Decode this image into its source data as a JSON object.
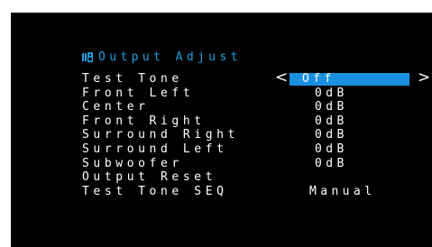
{
  "menu": {
    "title": "Output Adjust",
    "title_icon": "speaker-icon",
    "accent_color": "#1ea0e6",
    "highlight_color": "#1a8fe0",
    "background_color": "#000000"
  },
  "rows": [
    {
      "label": "Test Tone",
      "value": "Off",
      "selected": true
    },
    {
      "label": "Front Left",
      "value": "0dB"
    },
    {
      "label": "Center",
      "value": "0dB"
    },
    {
      "label": "Front Right",
      "value": "0dB"
    },
    {
      "label": "Surround Right",
      "value": "0dB"
    },
    {
      "label": "Surround Left",
      "value": "0dB"
    },
    {
      "label": "Subwoofer",
      "value": "0dB"
    },
    {
      "label": "Output Reset",
      "value": ""
    },
    {
      "label": "Test Tone SEQ",
      "value": "Manual"
    }
  ],
  "selector": {
    "left_arrow": "<",
    "right_arrow": ">"
  }
}
